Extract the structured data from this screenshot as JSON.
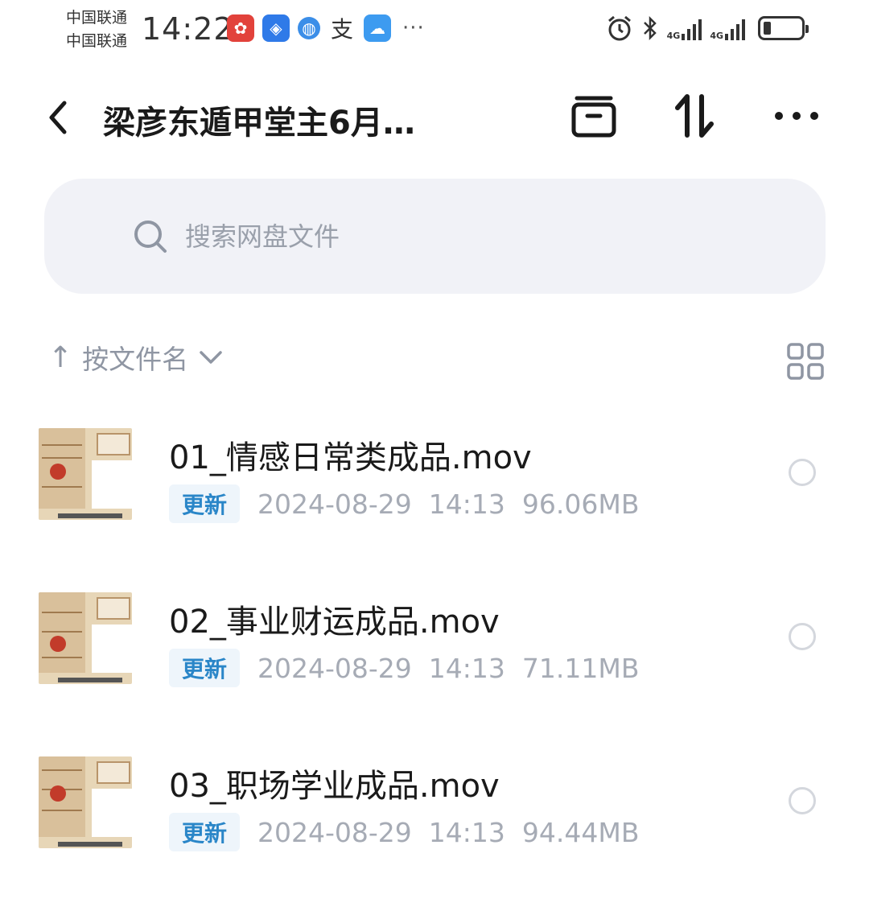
{
  "status_bar": {
    "carriers": [
      "中国联通",
      "中国联通"
    ],
    "time": "14:22",
    "notification_icons": [
      "app-red-icon",
      "app-blue-shield-icon",
      "globe-icon",
      "alipay-icon",
      "weather-icon"
    ],
    "more": "···",
    "network_1": "4G",
    "network_2": "4G",
    "battery_level": 0.2
  },
  "header": {
    "title": "梁彦东遁甲堂主6月…"
  },
  "search": {
    "placeholder": "搜索网盘文件"
  },
  "sort": {
    "label": "按文件名"
  },
  "files": [
    {
      "name": "01_情感日常类成品.mov",
      "badge": "更新",
      "date": "2024-08-29",
      "time": "14:13",
      "size": "96.06MB"
    },
    {
      "name": "02_事业财运成品.mov",
      "badge": "更新",
      "date": "2024-08-29",
      "time": "14:13",
      "size": "71.11MB"
    },
    {
      "name": "03_职场学业成品.mov",
      "badge": "更新",
      "date": "2024-08-29",
      "time": "14:13",
      "size": "94.44MB"
    }
  ],
  "colors": {
    "accent": "#2a86c8",
    "badge_bg": "#eef5fb",
    "muted_text": "#a6abb5",
    "search_bg": "#f1f2f7"
  }
}
